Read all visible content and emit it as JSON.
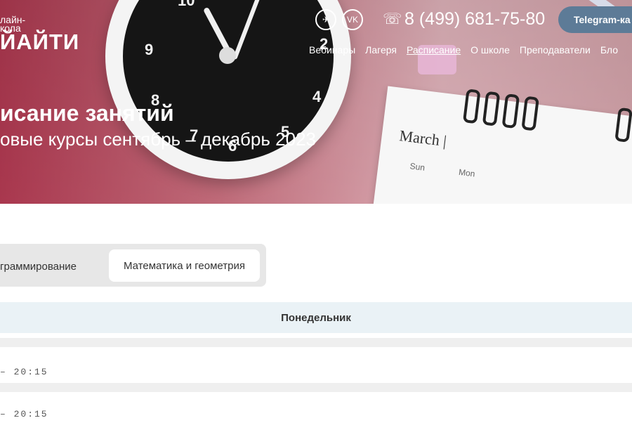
{
  "header": {
    "logo_top": "лайн-\nкола",
    "logo_main": "ЙАЙТИ",
    "phone": "8 (499) 681-75-80",
    "telegram_button": "Telegram-ка",
    "social": [
      {
        "name": "telegram-icon",
        "glyph": "✈"
      },
      {
        "name": "vk-icon",
        "glyph": "VK"
      }
    ],
    "nav": [
      "Вебинары",
      "Лагеря",
      "Расписание",
      "О школе",
      "Преподаватели",
      "Бло"
    ]
  },
  "hero": {
    "title": "исание занятий",
    "subtitle": "овые курсы сентябрь – декабрь 2023",
    "calendar_month": "March |",
    "calendar_days": [
      "Sun",
      "Mon"
    ]
  },
  "tabs": {
    "left": "граммирование",
    "right": "Математика и геометрия"
  },
  "schedule": {
    "day": "Понедельник",
    "rows": [
      "– 20:15",
      "– 20:15"
    ]
  }
}
